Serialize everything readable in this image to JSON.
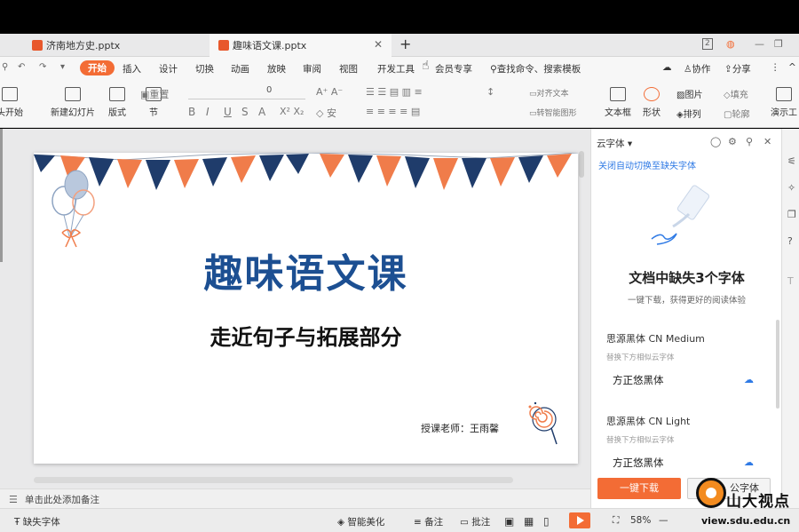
{
  "tabs": [
    {
      "label": "济南地方史.pptx",
      "active": false
    },
    {
      "label": "趣味语文课.pptx",
      "active": true
    }
  ],
  "window": {
    "badge": "2"
  },
  "menu": {
    "items": [
      "开始",
      "插入",
      "设计",
      "切换",
      "动画",
      "放映",
      "审阅",
      "视图",
      "开发工具",
      "会员专享"
    ],
    "search": "查找命令、搜索模板",
    "collab": "协作",
    "share": "分享"
  },
  "toolbar": {
    "from_start": "头开始",
    "new_slide": "新建幻灯片",
    "layout": "版式",
    "section": "节",
    "reset": "重置",
    "font_size": "0",
    "align_text": "对齐文本",
    "smart_shape": "转智能图形",
    "textbox": "文本框",
    "shape": "形状",
    "picture": "图片",
    "fill": "填充",
    "arrange": "排列",
    "outline": "轮廓",
    "present": "演示工"
  },
  "slide": {
    "title": "趣味语文课",
    "subtitle": "走近句子与拓展部分",
    "teacher": "授课老师：王雨馨"
  },
  "notes": {
    "placeholder": "单击此处添加备注"
  },
  "status": {
    "missing_fonts": "缺失字体",
    "beautify": "智能美化",
    "notes": "备注",
    "comments": "批注",
    "zoom": "58%"
  },
  "panel": {
    "title": "云字体",
    "toggle_link": "关闭自动切换至缺失字体",
    "heading": "文档中缺失3个字体",
    "description": "一键下载，获得更好的阅读体验",
    "fonts": [
      {
        "name": "思源黑体 CN Medium",
        "hint": "替换下方相似云字体",
        "replacement": "方正悠黑体"
      },
      {
        "name": "思源黑体 CN Light",
        "hint": "替换下方相似云字体",
        "replacement": "方正悠黑体"
      }
    ],
    "download_button": "一键下载",
    "office_font_button": "公字体"
  },
  "watermark": {
    "name": "山大视点",
    "url": "view.sdu.edu.cn"
  },
  "colors": {
    "accent": "#f36c35",
    "title_blue": "#1c4f92",
    "flag_navy": "#1f3c6b",
    "flag_orange": "#f07c4a",
    "link_blue": "#2f7ae5"
  }
}
